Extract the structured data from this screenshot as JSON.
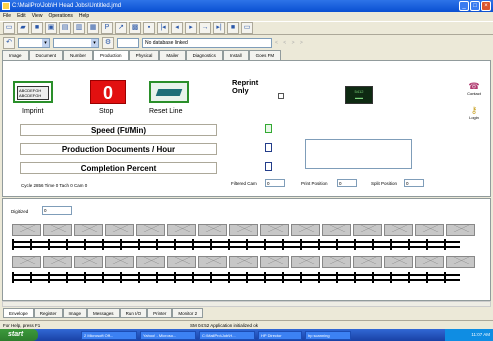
{
  "window": {
    "title": "C:\\MailPro\\Job\\H Head Jobs\\Untitled.jmd"
  },
  "menu": [
    "File",
    "Edit",
    "View",
    "Operations",
    "Help"
  ],
  "toolbar": {
    "db_status": "No database linked",
    "nav": "< < > >"
  },
  "tabs": [
    "Image",
    "Document",
    "Number",
    "Production",
    "Physical",
    "Mailer",
    "Diagnostics",
    "Install",
    "Goes FM"
  ],
  "active_tab": "Production",
  "controls": {
    "imprint": "Imprint",
    "stop": "Stop",
    "stop_value": "0",
    "reset": "Reset Line",
    "reprint_only": "Reprint Only",
    "imprint_text": [
      "ABCDEFGH",
      "ABCDEFGH"
    ],
    "counter_value": "5412"
  },
  "right_buttons": {
    "contact": "Contact",
    "login": "Login"
  },
  "stats": {
    "speed": "Speed (Ft/Min)",
    "production": "Production Documents / Hour",
    "completion": "Completion Percent"
  },
  "cycle_text": "Cycle 2856 Time 0 Tach 0 Cam 0",
  "fields": {
    "filtered_cam": {
      "label": "Filtered Cam",
      "value": "0"
    },
    "print_position": {
      "label": "Print Position",
      "value": "0"
    },
    "split_position": {
      "label": "Split Position",
      "value": "0"
    }
  },
  "digitized": {
    "label": "Digitized",
    "value": "0"
  },
  "bottom_tabs": [
    "Envelope",
    "Register",
    "Image",
    "Messages",
    "Run I/O",
    "Printer",
    "Monitor 2"
  ],
  "status": {
    "help": "For Help, press F1",
    "message": "SM 04:52 Application initialized ok"
  },
  "taskbar": {
    "start": "start",
    "tasks": [
      "2 Microsoft Off...",
      "Yahoo! - Microso...",
      "C:\\MailPro\\Job\\H...",
      "HP Director",
      "hp scanning"
    ],
    "clock": "11:07 AM"
  }
}
